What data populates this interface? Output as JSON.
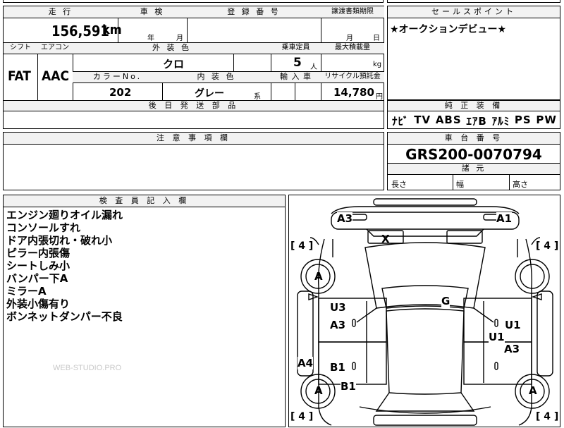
{
  "top": {
    "mileage_label": "走 行",
    "mileage_value": "156,591",
    "mileage_unit": "km",
    "inspection_label": "車 検",
    "inspection_year_unit": "年",
    "inspection_month_unit": "月",
    "registration_label": "登 録 番 号",
    "transfer_label": "譲渡書類期限",
    "transfer_month_unit": "月",
    "transfer_day_unit": "日"
  },
  "specs": {
    "shift_label": "シフト",
    "shift_value": "FAT",
    "aircon_label": "エアコン",
    "aircon_value": "AAC",
    "exterior_label": "外 装 色",
    "exterior_value": "クロ",
    "capacity_label": "乗車定員",
    "capacity_value": "5",
    "capacity_unit": "人",
    "maxload_label": "最大積載量",
    "maxload_unit": "kg",
    "color_no_label": "カラーNo.",
    "color_no_value": "202",
    "interior_label": "内 装 色",
    "interior_value": "グレー",
    "interior_suffix": "系",
    "import_label": "輸 入 車",
    "recycle_label": "リサイクル預託金",
    "recycle_value": "14,780",
    "recycle_unit": "円"
  },
  "later_parts_label": "後 日 発 送 部 品",
  "selling_points": {
    "label": "セールスポイント",
    "text": "★オークションデビュー★"
  },
  "equipment": {
    "label": "純 正 装 備",
    "items": [
      "ﾅﾋﾞ",
      "TV",
      "ABS",
      "ｴｱB",
      "ｱﾙﾐ",
      "PS",
      "PW"
    ]
  },
  "notes_label": "注 意 事 項 欄",
  "chassis": {
    "label": "車 台 番 号",
    "value": "GRS200-0070794",
    "dims_label": "諸 元",
    "length_label": "長さ",
    "width_label": "幅",
    "height_label": "高さ"
  },
  "inspector": {
    "label": "検 査 員 記 入 欄",
    "lines": [
      "エンジン廻りオイル漏れ",
      "コンソールすれ",
      "ドア内張切れ・破れ小",
      "ピラー内張傷",
      "シートしみ小",
      "バンパー下A",
      "ミラーA",
      "外装小傷有り",
      "ボンネットダンパー不良"
    ]
  },
  "watermark": "WEB-STUDIO.PRO",
  "diagram": {
    "labels": {
      "a3_top": "A3",
      "a1_top": "A1",
      "x": "X",
      "g": "G",
      "u3": "U3",
      "a3_left": "A3",
      "a4": "A4",
      "b1_left_inner": "B1",
      "b1_left_outer": "B1",
      "u1_right": "U1",
      "u1_inner": "U1",
      "a3_right": "A3",
      "wheel_fl": "A",
      "wheel_rl": "A",
      "wheel_rr": "A",
      "tire_tl": "[ 4 ]",
      "tire_tr": "[ 4 ]",
      "tire_bl": "[ 4 ]",
      "tire_br": "[ 4 ]"
    }
  }
}
